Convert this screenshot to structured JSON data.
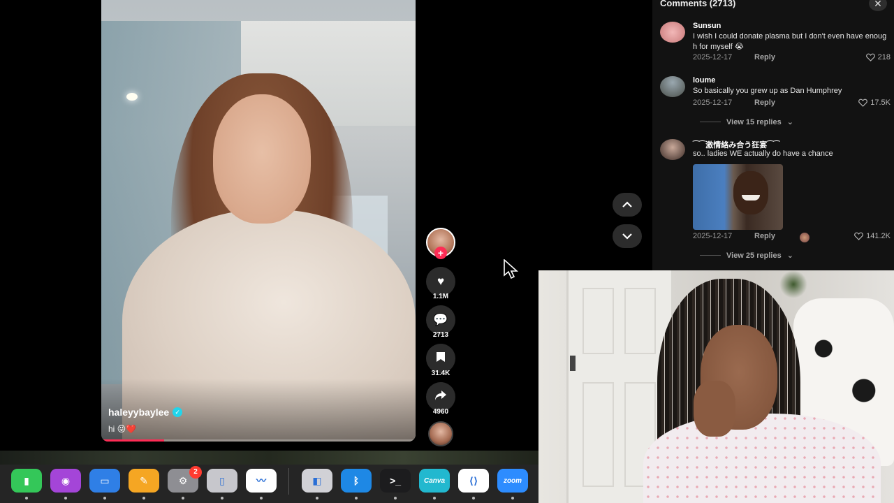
{
  "video": {
    "creator": "haleyybaylee",
    "caption": "hi 😝❤️",
    "progress_fraction": 0.2
  },
  "actions": {
    "likes": "1.1M",
    "comments": "2713",
    "saves": "31.4K",
    "shares": "4960",
    "follow_symbol": "+"
  },
  "comments_panel": {
    "title": "Comments (2713)",
    "close_symbol": "✕",
    "items": [
      {
        "user": "Sunsun",
        "text": "I wish I could donate plasma but I don't even have enough for myself 😭",
        "date": "2025-12-17",
        "reply": "Reply",
        "likes": "218"
      },
      {
        "user": "loume",
        "text": "So basically you grew up as Dan Humphrey",
        "date": "2025-12-17",
        "reply": "Reply",
        "likes": "17.5K",
        "view_replies": "View 15 replies"
      },
      {
        "user": "⁀⁀激情絡み合う狂宴⁀⁀",
        "text": "so.. ladies WE actually do have a chance",
        "date": "2025-12-17",
        "reply": "Reply",
        "likes": "141.2K",
        "view_replies": "View 25 replies"
      }
    ]
  },
  "dock": {
    "icons": [
      {
        "name": "numbers-icon",
        "color": "#34c759",
        "glyph": "▮"
      },
      {
        "name": "podcasts-icon",
        "color": "#a445d8",
        "glyph": "◉"
      },
      {
        "name": "keynote-icon",
        "color": "#2f7fe6",
        "glyph": "▭"
      },
      {
        "name": "pages-icon",
        "color": "#f5a623",
        "glyph": "✎"
      },
      {
        "name": "system-settings-icon",
        "color": "#8e8e93",
        "glyph": "⚙"
      },
      {
        "name": "iphone-mirroring-icon",
        "color": "#c7c7cc",
        "glyph": "▯"
      },
      {
        "name": "freeform-icon",
        "color": "#ffffff",
        "glyph": "〰"
      },
      {
        "name": "disk-utility-icon",
        "color": "#d1d1d6",
        "glyph": "◧"
      },
      {
        "name": "bluetooth-icon",
        "color": "#1e88e5",
        "glyph": "ᛒ"
      },
      {
        "name": "terminal-icon",
        "color": "#1c1c1e",
        "glyph": ">_"
      },
      {
        "name": "canva-icon",
        "color": "#22b8cf",
        "glyph": "Canva"
      },
      {
        "name": "vscode-icon",
        "color": "#ffffff",
        "glyph": "⟨⟩"
      },
      {
        "name": "zoom-icon",
        "color": "#2d8cff",
        "glyph": "zoom"
      }
    ],
    "settings_badge": "2"
  }
}
